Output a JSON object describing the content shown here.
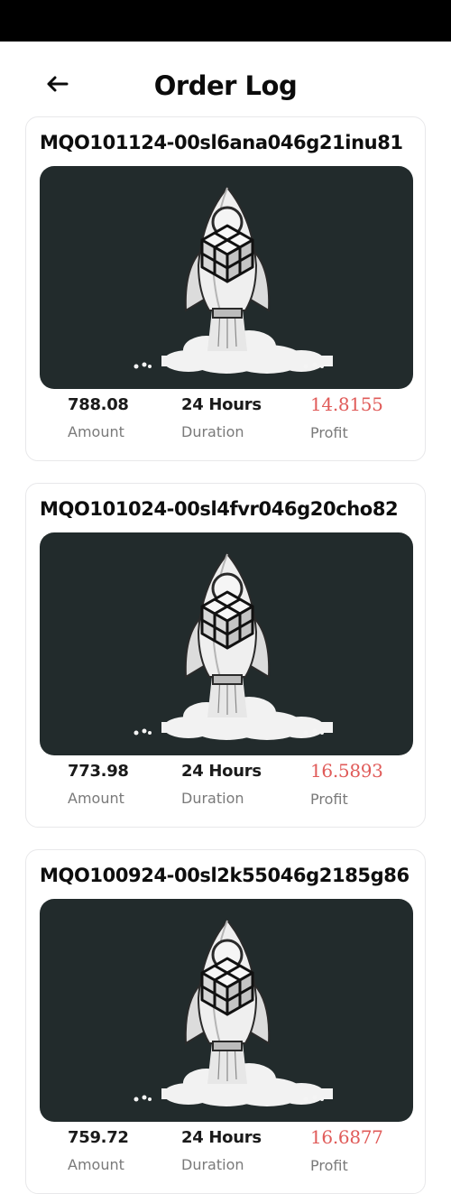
{
  "header": {
    "title": "Order Log",
    "back_icon": "arrow-left-icon"
  },
  "labels": {
    "amount": "Amount",
    "duration": "Duration",
    "profit": "Profit"
  },
  "colors": {
    "profit": "#e05b59",
    "image_background": "#222b2c"
  },
  "orders": [
    {
      "order_id": "MQO101124-00sl6ana046g21inu81",
      "amount": "788.08",
      "duration": "24 Hours",
      "profit": "14.8155",
      "image": "rocket-icon"
    },
    {
      "order_id": "MQO101024-00sl4fvr046g20cho82",
      "amount": "773.98",
      "duration": "24 Hours",
      "profit": "16.5893",
      "image": "rocket-icon"
    },
    {
      "order_id": "MQO100924-00sl2k55046g2185g86",
      "amount": "759.72",
      "duration": "24 Hours",
      "profit": "16.6877",
      "image": "rocket-icon"
    }
  ]
}
